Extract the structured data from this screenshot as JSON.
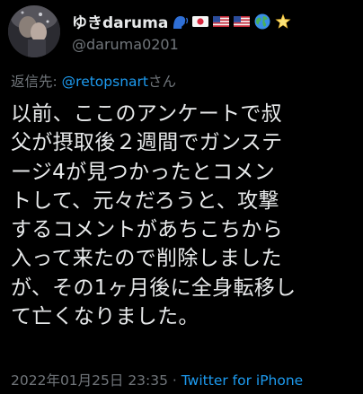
{
  "author": {
    "display_name": "ゆきdaruma",
    "handle": "@daruma0201",
    "emojis": [
      "speaking-head-icon",
      "japan-flag-icon",
      "us-flag-icon",
      "us-flag-icon",
      "globe-icon",
      "star-icon"
    ]
  },
  "reply": {
    "prefix": "返信先: ",
    "mention": "@retopsnart",
    "suffix": "さん"
  },
  "tweet": {
    "lines": [
      "以前、ここのアンケートで叔",
      "父が摂取後２週間でガンステ",
      "ージ4が見つかったとコメン",
      "トして、元々だろうと、攻撃",
      "するコメントがあちこちから",
      "入って来たので削除しました",
      "が、その1ヶ月後に全身転移し",
      "て亡くなりました。"
    ]
  },
  "meta": {
    "timestamp": "2022年01月25日 23:35",
    "separator": " · ",
    "source": "Twitter for iPhone"
  },
  "colors": {
    "background": "#000000",
    "text": "#e7e9ea",
    "secondary": "#71767b",
    "link": "#1d9bf0"
  }
}
